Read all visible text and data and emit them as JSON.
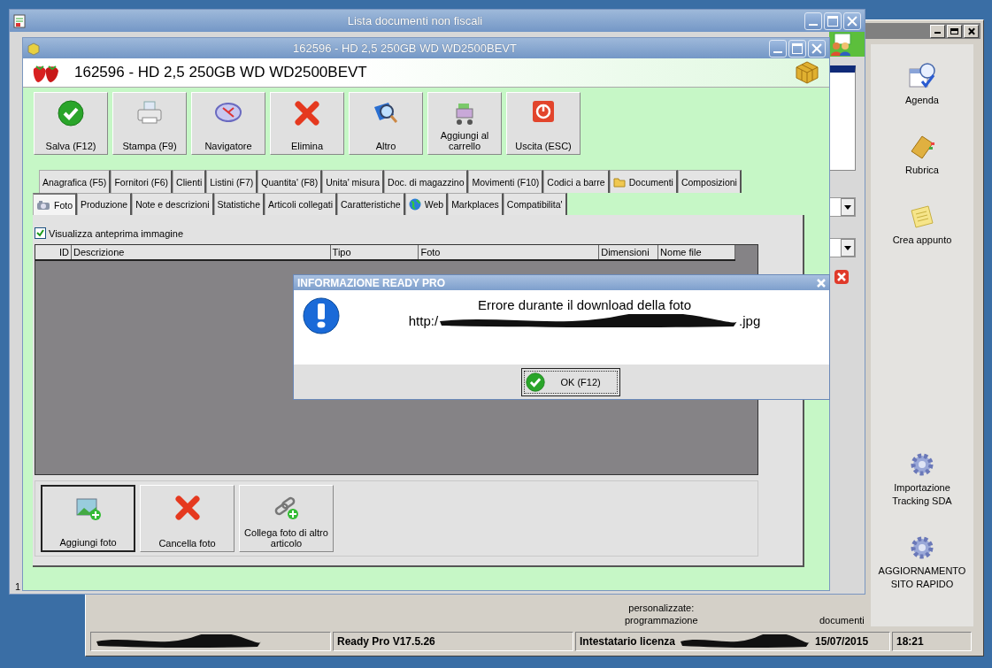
{
  "back_window": {
    "shortcuts": [
      {
        "label": "Agenda",
        "kind": "agenda"
      },
      {
        "label": "Rubrica",
        "kind": "book"
      },
      {
        "label": "Crea appunto",
        "kind": "note"
      },
      {
        "label": "Importazione Tracking SDA",
        "kind": "gear"
      },
      {
        "label": "AGGIORNAMENTO SITO RAPIDO",
        "kind": "gear"
      }
    ],
    "partial_labels": [
      "personalizzate:\nprogrammazione",
      "documenti"
    ],
    "status_bar": {
      "version": "Ready Pro V17.5.26",
      "license_label": "Intestatario licenza",
      "date": "15/07/2015",
      "time": "18:21"
    }
  },
  "list_window": {
    "title": "Lista documenti non fiscali",
    "status_count": "1"
  },
  "article_window": {
    "title": "162596 - HD 2,5 250GB WD WD2500BEVT",
    "heading": "162596 - HD 2,5 250GB WD WD2500BEVT",
    "toolbar": [
      {
        "label": "Salva (F12)",
        "kind": "check"
      },
      {
        "label": "Stampa (F9)",
        "kind": "printer"
      },
      {
        "label": "Navigatore",
        "kind": "compass"
      },
      {
        "label": "Elimina",
        "kind": "cross"
      },
      {
        "label": "Altro",
        "kind": "magnifier"
      },
      {
        "label": "Aggiungi al carrello",
        "kind": "cart"
      },
      {
        "label": "Uscita (ESC)",
        "kind": "power"
      }
    ],
    "tabs_row_1": [
      {
        "label": "Anagrafica (F5)",
        "selected": false
      },
      {
        "label": "Fornitori (F6)",
        "selected": false
      },
      {
        "label": "Clienti",
        "selected": false
      },
      {
        "label": "Listini (F7)",
        "selected": false
      },
      {
        "label": "Quantita' (F8)",
        "selected": false
      },
      {
        "label": "Unita' misura",
        "selected": false
      },
      {
        "label": "Doc. di magazzino",
        "selected": false
      },
      {
        "label": "Movimenti (F10)",
        "selected": false
      },
      {
        "label": "Codici a barre",
        "selected": false
      },
      {
        "label": "Documenti",
        "selected": false,
        "kind": "folder"
      },
      {
        "label": "Composizioni",
        "selected": false
      }
    ],
    "tabs_row_2": [
      {
        "label": "Foto",
        "selected": true,
        "kind": "camera"
      },
      {
        "label": "Produzione",
        "selected": false
      },
      {
        "label": "Note e descrizioni",
        "selected": false
      },
      {
        "label": "Statistiche",
        "selected": false
      },
      {
        "label": "Articoli collegati",
        "selected": false
      },
      {
        "label": "Caratteristiche",
        "selected": false
      },
      {
        "label": "Web",
        "selected": false,
        "kind": "globe"
      },
      {
        "label": "Markplaces",
        "selected": false
      },
      {
        "label": "Compatibilita'",
        "selected": false
      }
    ],
    "preview_checkbox": {
      "label": "Visualizza anteprima immagine",
      "checked": true
    },
    "table": {
      "columns": [
        "ID",
        "Descrizione",
        "Tipo",
        "Foto",
        "Dimensioni",
        "Nome file"
      ]
    },
    "photo_buttons": [
      {
        "label": "Aggiungi foto",
        "kind": "image-add"
      },
      {
        "label": "Cancella foto",
        "kind": "cross"
      },
      {
        "label": "Collega foto di altro articolo",
        "kind": "link-add"
      }
    ]
  },
  "dialog": {
    "title": "INFORMAZIONE READY PRO",
    "message": "Errore durante il download della foto",
    "url_start": "http:/",
    "url_end": ".jpg",
    "button": "OK (F12)"
  }
}
